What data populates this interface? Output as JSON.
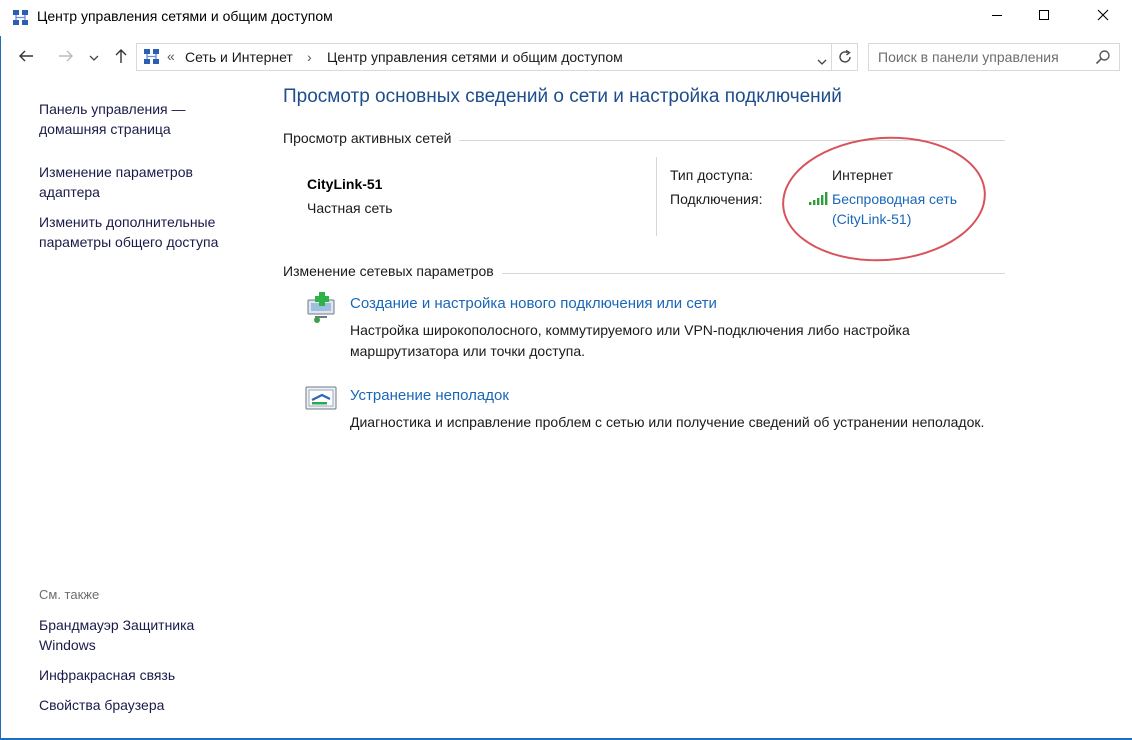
{
  "window": {
    "title": "Центр управления сетями и общим доступом",
    "icon": "network-center-icon",
    "controls": [
      "minimize-icon",
      "maximize-icon",
      "close-icon"
    ]
  },
  "address": {
    "prefix": "«",
    "crumbs": [
      "Сеть и Интернет",
      "Центр управления сетями и общим доступом"
    ],
    "separator": "›",
    "search_placeholder": "Поиск в панели управления"
  },
  "left_pane": {
    "links": [
      "Панель управления —\nдомашняя страница",
      "Изменение параметров\nадаптера",
      "Изменить дополнительные\nпараметры общего доступа"
    ],
    "see_also_label": "См. также",
    "see_also": [
      "Брандмауэр Защитника\nWindows",
      "Инфракрасная связь",
      "Свойства браузера"
    ]
  },
  "main": {
    "heading": "Просмотр основных сведений о сети и настройка подключений",
    "active_networks_label": "Просмотр активных сетей",
    "network": {
      "name": "CityLink-51",
      "type": "Частная сеть",
      "access_type_label": "Тип доступа:",
      "access_type_value": "Интернет",
      "connections_label": "Подключения:",
      "connection_line1": "Беспроводная сеть",
      "connection_line2": "(CityLink-51)"
    },
    "change_settings_label": "Изменение сетевых параметров",
    "tasks": [
      {
        "title": "Создание и настройка нового подключения или сети",
        "desc": "Настройка широкополосного, коммутируемого или VPN-подключения либо настройка маршрутизатора или точки доступа.",
        "icon": "new-connection-icon"
      },
      {
        "title": "Устранение неполадок",
        "desc": "Диагностика и исправление проблем с сетью или получение сведений об устранении неполадок.",
        "icon": "troubleshoot-icon"
      }
    ]
  },
  "colors": {
    "heading": "#1e4d8c",
    "link": "#1a67b8",
    "annotation": "#d8525c",
    "wifi": "#2e9e3a"
  }
}
